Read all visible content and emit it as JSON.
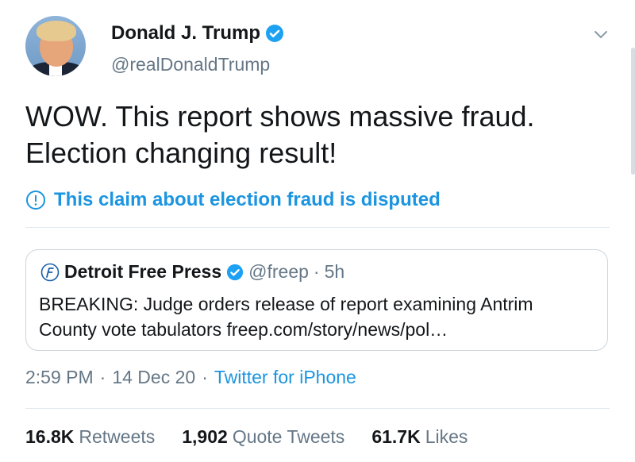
{
  "author": {
    "name": "Donald J. Trump",
    "handle": "@realDonaldTrump",
    "avatar_icon": "profile-photo",
    "verified_icon": "verified-badge-icon"
  },
  "tweet": {
    "text_line1": "WOW. This report shows massive fraud.",
    "text_line2": "Election changing result!"
  },
  "label": {
    "icon": "info-circle-icon",
    "text": "This claim about election fraud is disputed"
  },
  "quoted": {
    "name": "Detroit Free Press",
    "handle": "@freep",
    "separator": "·",
    "time": "5h",
    "body_line1": "BREAKING: Judge orders release of report examining Antrim",
    "body_line2": "County vote tabulators freep.com/story/news/pol…"
  },
  "meta": {
    "time": "2:59 PM",
    "sep1": "·",
    "date": "14 Dec 20",
    "sep2": "·",
    "source": "Twitter for iPhone"
  },
  "stats": [
    {
      "value": "16.8K",
      "label": "Retweets"
    },
    {
      "value": "1,902",
      "label": "Quote Tweets"
    },
    {
      "value": "61.7K",
      "label": "Likes"
    }
  ],
  "colors": {
    "accent": "#1b95e0",
    "text": "#14171a",
    "secondary": "#657786",
    "border": "#e1e8ed"
  }
}
